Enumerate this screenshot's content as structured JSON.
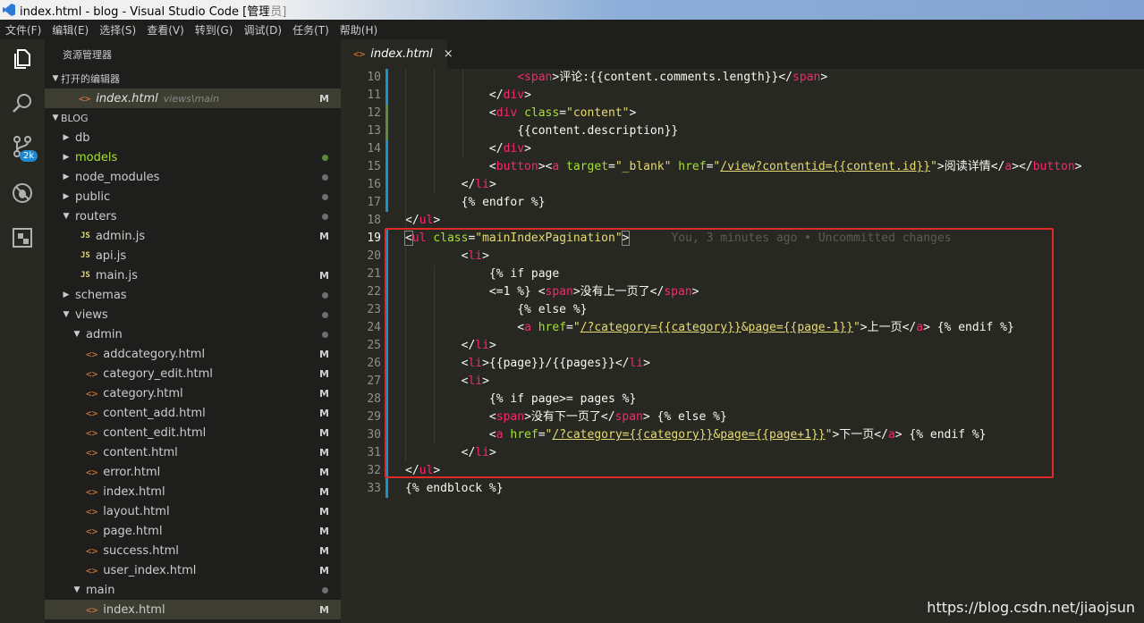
{
  "window": {
    "title": "index.html - blog - Visual Studio Code [管理员]"
  },
  "menu": [
    "文件(F)",
    "编辑(E)",
    "选择(S)",
    "查看(V)",
    "转到(G)",
    "调试(D)",
    "任务(T)",
    "帮助(H)"
  ],
  "activity": {
    "badge": "2k"
  },
  "explorer": {
    "title": "资源管理器",
    "open_editors_header": "打开的编辑器",
    "open_editor": {
      "name": "index.html",
      "path": "views\\main",
      "status": "M"
    },
    "project_header": "BLOG",
    "tree": [
      {
        "label": "db",
        "kind": "folder-closed",
        "indent": 0,
        "status": ""
      },
      {
        "label": "models",
        "kind": "folder-closed",
        "indent": 0,
        "status": "dot-green",
        "green": true
      },
      {
        "label": "node_modules",
        "kind": "folder-closed",
        "indent": 0,
        "status": "dot"
      },
      {
        "label": "public",
        "kind": "folder-closed",
        "indent": 0,
        "status": "dot"
      },
      {
        "label": "routers",
        "kind": "folder-open",
        "indent": 0,
        "status": "dot"
      },
      {
        "label": "admin.js",
        "kind": "js",
        "indent": 1,
        "status": "M"
      },
      {
        "label": "api.js",
        "kind": "js",
        "indent": 1,
        "status": ""
      },
      {
        "label": "main.js",
        "kind": "js",
        "indent": 1,
        "status": "M"
      },
      {
        "label": "schemas",
        "kind": "folder-closed",
        "indent": 0,
        "status": "dot"
      },
      {
        "label": "views",
        "kind": "folder-open",
        "indent": 0,
        "status": "dot"
      },
      {
        "label": "admin",
        "kind": "folder-open",
        "indent": 1,
        "status": "dot"
      },
      {
        "label": "addcategory.html",
        "kind": "html",
        "indent": 2,
        "status": "M"
      },
      {
        "label": "category_edit.html",
        "kind": "html",
        "indent": 2,
        "status": "M"
      },
      {
        "label": "category.html",
        "kind": "html",
        "indent": 2,
        "status": "M"
      },
      {
        "label": "content_add.html",
        "kind": "html",
        "indent": 2,
        "status": "M"
      },
      {
        "label": "content_edit.html",
        "kind": "html",
        "indent": 2,
        "status": "M"
      },
      {
        "label": "content.html",
        "kind": "html",
        "indent": 2,
        "status": "M"
      },
      {
        "label": "error.html",
        "kind": "html",
        "indent": 2,
        "status": "M"
      },
      {
        "label": "index.html",
        "kind": "html",
        "indent": 2,
        "status": "M"
      },
      {
        "label": "layout.html",
        "kind": "html",
        "indent": 2,
        "status": "M"
      },
      {
        "label": "page.html",
        "kind": "html",
        "indent": 2,
        "status": "M"
      },
      {
        "label": "success.html",
        "kind": "html",
        "indent": 2,
        "status": "M"
      },
      {
        "label": "user_index.html",
        "kind": "html",
        "indent": 2,
        "status": "M"
      },
      {
        "label": "main",
        "kind": "folder-open",
        "indent": 1,
        "status": "dot"
      },
      {
        "label": "index.html",
        "kind": "html",
        "indent": 2,
        "status": "M",
        "selected": true
      }
    ]
  },
  "tab": {
    "name": "index.html",
    "close": "×"
  },
  "code": [
    {
      "n": "10",
      "html": "                <span class=\"t\">&lt;span</span>&gt;评论:{{content.comments.length}}&lt;/<span class=\"t\">span</span>&gt;"
    },
    {
      "n": "11",
      "html": "            &lt;/<span class=\"t\">div</span>&gt;"
    },
    {
      "n": "12",
      "html": "            &lt;<span class=\"t\">div</span> <span class=\"a\">class</span>=<span class=\"s\">\"content\"</span>&gt;"
    },
    {
      "n": "13",
      "html": "                {{content.description}}"
    },
    {
      "n": "14",
      "html": "            &lt;/<span class=\"t\">div</span>&gt;"
    },
    {
      "n": "15",
      "html": "            &lt;<span class=\"t\">button</span>&gt;&lt;<span class=\"t\">a</span> <span class=\"a\">target</span>=<span class=\"s\">\"_blank\"</span> <span class=\"a\">href</span>=<span class=\"s\">\"<span class=\"u\">/view?contentid={{content.id}}</span>\"</span>&gt;阅读详情&lt;/<span class=\"t\">a</span>&gt;&lt;/<span class=\"t\">button</span>&gt;"
    },
    {
      "n": "16",
      "html": "        &lt;/<span class=\"t\">li</span>&gt;"
    },
    {
      "n": "17",
      "html": "        {% endfor %}"
    },
    {
      "n": "18",
      "html": "&lt;/<span class=\"t\">ul</span>&gt;"
    },
    {
      "n": "19",
      "html": "<span class=\"bracket\">&lt;</span><span class=\"t\">ul</span> <span class=\"a\">class</span>=<span class=\"s\">\"mainIndexPagination\"</span><span class=\"bracket\">&gt;</span>      <span class=\"blame\">You, 3 minutes ago • Uncommitted changes</span>",
      "current": true
    },
    {
      "n": "20",
      "html": "        &lt;<span class=\"t\">li</span>&gt;"
    },
    {
      "n": "21",
      "html": "            {% if page"
    },
    {
      "n": "22",
      "html": "            &lt;=1 %} &lt;<span class=\"t\">span</span>&gt;没有上一页了&lt;/<span class=\"t\">span</span>&gt;"
    },
    {
      "n": "23",
      "html": "                {% else %}"
    },
    {
      "n": "24",
      "html": "                &lt;<span class=\"t\">a</span> <span class=\"a\">href</span>=<span class=\"s\">\"<span class=\"u\">/?category={{category}}</span>&amp;<span class=\"u\">page={{page-1}}</span>\"</span>&gt;上一页&lt;/<span class=\"t\">a</span>&gt; {% endif %}"
    },
    {
      "n": "25",
      "html": "        &lt;/<span class=\"t\">li</span>&gt;"
    },
    {
      "n": "26",
      "html": "        &lt;<span class=\"t\">li</span>&gt;{{page}}/{{pages}}&lt;/<span class=\"t\">li</span>&gt;"
    },
    {
      "n": "27",
      "html": "        &lt;<span class=\"t\">li</span>&gt;"
    },
    {
      "n": "28",
      "html": "            {% if page&gt;= pages %}"
    },
    {
      "n": "29",
      "html": "            &lt;<span class=\"t\">span</span>&gt;没有下一页了&lt;/<span class=\"t\">span</span>&gt; {% else %}"
    },
    {
      "n": "30",
      "html": "            &lt;<span class=\"t\">a</span> <span class=\"a\">href</span>=<span class=\"s\">\"<span class=\"u\">/?category={{category}}</span>&amp;<span class=\"u\">page={{page+1}}</span>\"</span>&gt;下一页&lt;/<span class=\"t\">a</span>&gt; {% endif %}"
    },
    {
      "n": "31",
      "html": "        &lt;/<span class=\"t\">li</span>&gt;"
    },
    {
      "n": "32",
      "html": "&lt;/<span class=\"t\">ul</span>&gt;"
    },
    {
      "n": "33",
      "html": "{% endblock %}"
    }
  ],
  "gutter_marks": {
    "10": "mod",
    "11": "mod",
    "12": "add",
    "13": "add",
    "14": "mod",
    "15": "mod",
    "16": "mod",
    "17": "mod",
    "19": "mod",
    "20": "mod",
    "21": "mod",
    "22": "mod",
    "23": "mod",
    "24": "mod",
    "25": "mod",
    "26": "mod",
    "27": "mod",
    "28": "mod",
    "29": "mod",
    "30": "mod",
    "31": "mod",
    "32": "mod",
    "33": "mod"
  },
  "watermark": "https://blog.csdn.net/jiaojsun",
  "colors": {
    "tag": "#f92672",
    "attr": "#a6e22e",
    "string": "#e6db74",
    "highlight_box": "#e02a25"
  }
}
